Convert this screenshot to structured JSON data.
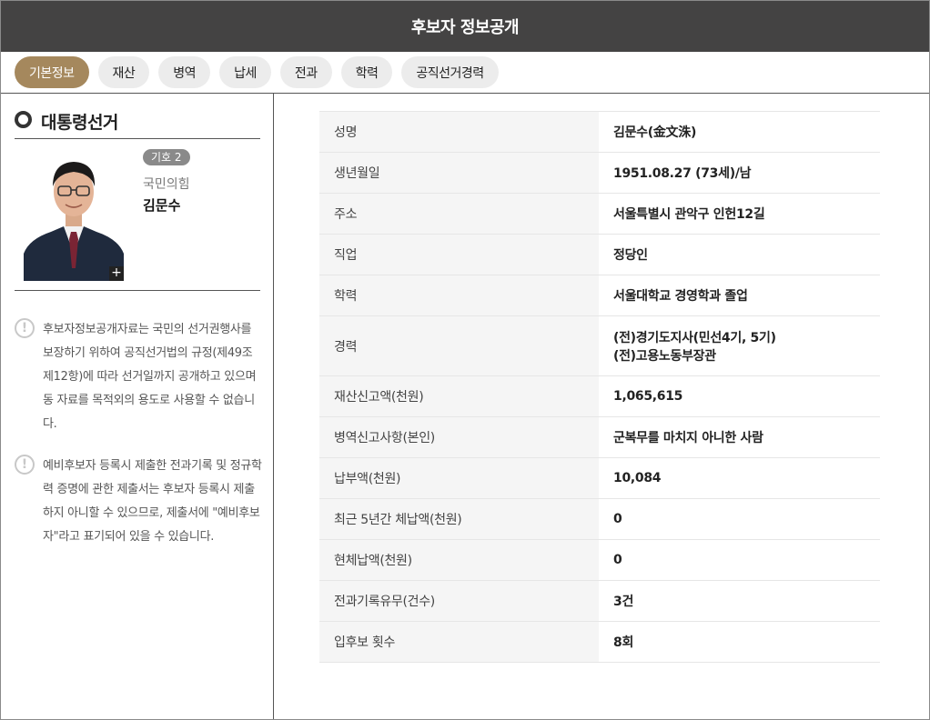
{
  "header": {
    "title": "후보자 정보공개"
  },
  "tabs": [
    {
      "label": "기본정보",
      "active": true
    },
    {
      "label": "재산"
    },
    {
      "label": "병역"
    },
    {
      "label": "납세"
    },
    {
      "label": "전과"
    },
    {
      "label": "학력"
    },
    {
      "label": "공직선거경력"
    }
  ],
  "sidebar": {
    "election_title": "대통령선거",
    "candidate": {
      "badge": "기호 2",
      "party": "국민의힘",
      "name": "김문수",
      "zoom_label": "+"
    },
    "notices": [
      "후보자정보공개자료는 국민의 선거권행사를 보장하기 위하여 공직선거법의 규정(제49조 제12항)에 따라 선거일까지 공개하고 있으며 동 자료를 목적외의 용도로 사용할 수 없습니다.",
      "예비후보자 등록시 제출한 전과기록 및 정규학력 증명에 관한 제출서는 후보자 등록시 제출하지 아니할 수 있으므로, 제출서에 \"예비후보자\"라고 표기되어 있을 수 있습니다."
    ],
    "notice_icon": "!"
  },
  "info": {
    "rows": [
      {
        "label": "성명",
        "value": "김문수(金文洙)"
      },
      {
        "label": "생년월일",
        "value": "1951.08.27 (73세)/남"
      },
      {
        "label": "주소",
        "value": "서울특별시 관악구 인헌12길"
      },
      {
        "label": "직업",
        "value": "정당인"
      },
      {
        "label": "학력",
        "value": "서울대학교 경영학과 졸업"
      },
      {
        "label": "경력",
        "value": "(전)경기도지사(민선4기, 5기)",
        "value2": "(전)고용노동부장관"
      },
      {
        "label": "재산신고액(천원)",
        "value": "1,065,615"
      },
      {
        "label": "병역신고사항(본인)",
        "value": "군복무를 마치지 아니한 사람"
      },
      {
        "label": "납부액(천원)",
        "value": "10,084"
      },
      {
        "label": "최근 5년간 체납액(천원)",
        "value": "0"
      },
      {
        "label": "현체납액(천원)",
        "value": "0"
      },
      {
        "label": "전과기록유무(건수)",
        "value": "3건"
      },
      {
        "label": "입후보 횟수",
        "value": "8회"
      }
    ]
  },
  "colors": {
    "header_bg": "#444343",
    "active_tab": "#a5885d",
    "tab_bg": "#ececec"
  }
}
